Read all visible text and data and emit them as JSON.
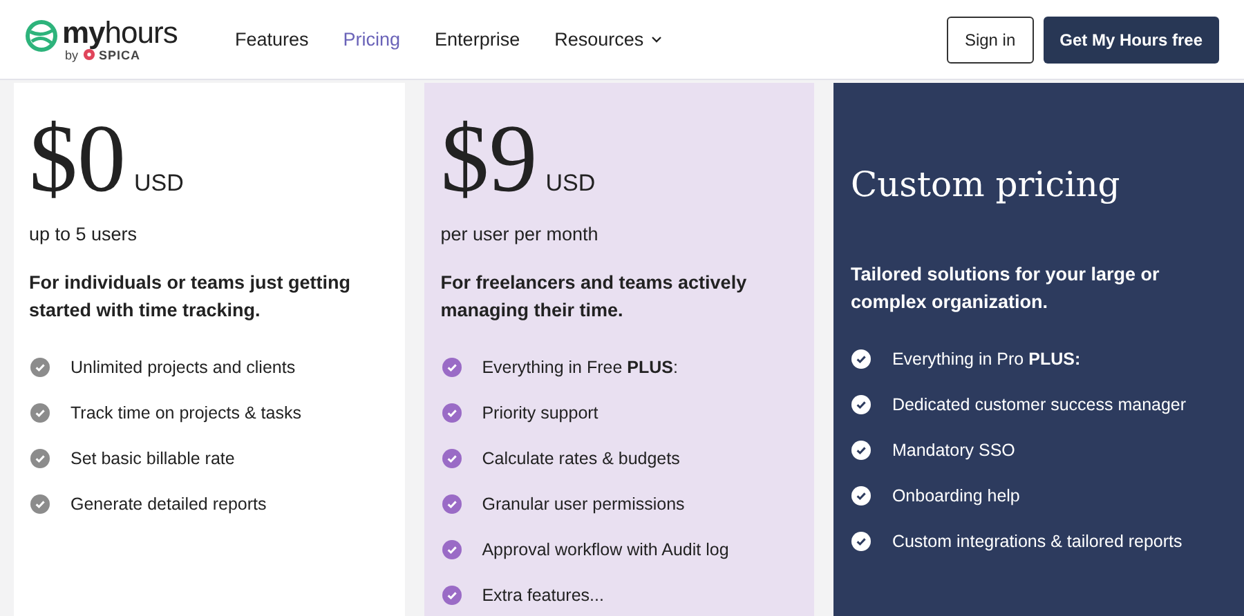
{
  "header": {
    "logo": {
      "wordmark": "**my**hours",
      "by": "by",
      "maker": "SPICA"
    },
    "nav": [
      {
        "label": "Features",
        "selected": false,
        "dropdown": false
      },
      {
        "label": "Pricing",
        "selected": true,
        "dropdown": false
      },
      {
        "label": "Enterprise",
        "selected": false,
        "dropdown": false
      },
      {
        "label": "Resources",
        "selected": false,
        "dropdown": true
      }
    ],
    "sign_in": "Sign in",
    "cta": "Get My Hours free"
  },
  "plans": [
    {
      "kind": "free",
      "price": "$0",
      "currency": "USD",
      "unit": "up to 5 users",
      "description": "For individuals or teams just getting started with time tracking.",
      "features": [
        "Unlimited projects and clients",
        "Track time on projects & tasks",
        "Set basic billable rate",
        "Generate detailed reports"
      ]
    },
    {
      "kind": "pro",
      "price": "$9",
      "currency": "USD",
      "unit": "per user per month",
      "description": "For freelancers and teams actively managing their time.",
      "features": [
        "Everything in Free **PLUS**:",
        "Priority support",
        "Calculate rates & budgets",
        "Granular user permissions",
        "Approval workflow with Audit log",
        "Extra features..."
      ]
    },
    {
      "kind": "custom",
      "title": "Custom pricing",
      "description": "Tailored solutions for your large or complex organization.",
      "features": [
        "Everything in Pro **PLUS:**",
        "Dedicated customer success manager",
        "Mandatory SSO",
        "Onboarding help",
        "Custom integrations & tailored reports"
      ]
    }
  ]
}
